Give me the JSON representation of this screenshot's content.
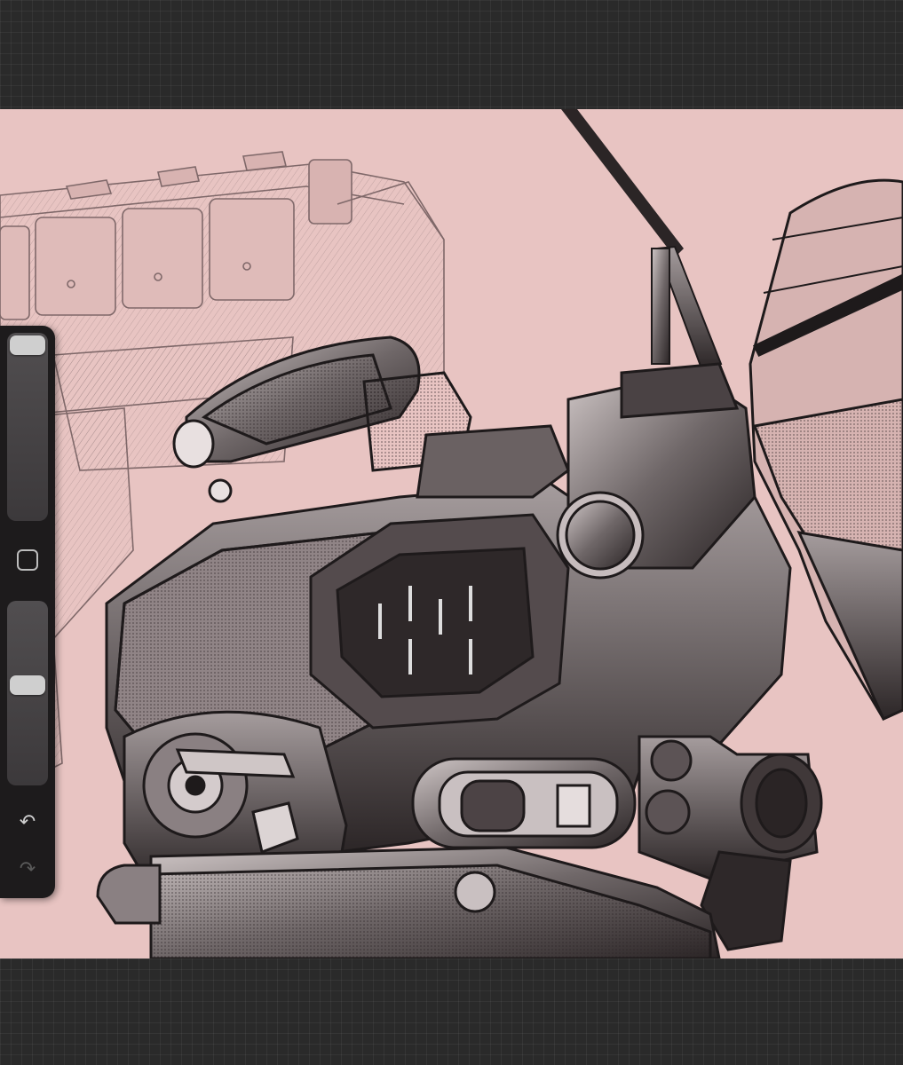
{
  "app": {
    "background_color": "#2a2a2a",
    "canvas_color": "#e8c4c2",
    "artwork_subject": "mech-robot-illustration"
  },
  "sidebar": {
    "brush_size": {
      "level": 0.0
    },
    "modify_button": {
      "icon": "square-icon"
    },
    "opacity": {
      "level": 0.45
    },
    "undo": {
      "icon": "undo-arrow-icon",
      "enabled": true
    },
    "redo": {
      "icon": "redo-arrow-icon",
      "enabled": false
    }
  }
}
